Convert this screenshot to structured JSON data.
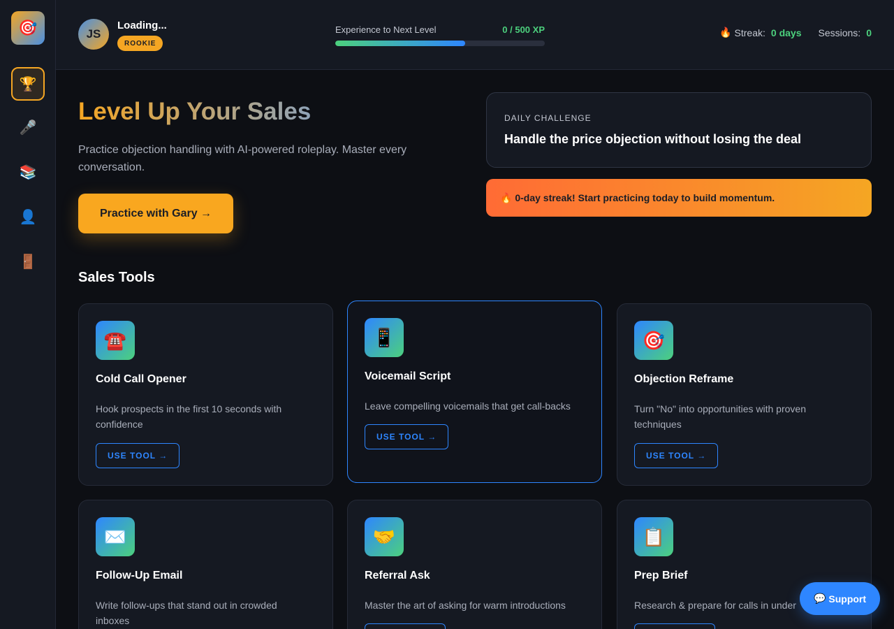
{
  "sidebar": {
    "logo_icon": "🎯",
    "items": [
      {
        "name": "dashboard",
        "icon": "🏆",
        "active": true
      },
      {
        "name": "practice",
        "icon": "🎤",
        "active": false
      },
      {
        "name": "library",
        "icon": "📚",
        "active": false
      },
      {
        "name": "profile",
        "icon": "👤",
        "active": false
      },
      {
        "name": "logout",
        "icon": "🚪",
        "active": false
      }
    ]
  },
  "header": {
    "avatar_initials": "JS",
    "user_name": "Loading...",
    "rank": "ROOKIE",
    "xp_label": "Experience to Next Level",
    "xp_value": "0 / 500 XP",
    "streak_icon": "🔥",
    "streak_label": "Streak:",
    "streak_value": "0 days",
    "sessions_label": "Sessions:",
    "sessions_value": "0"
  },
  "hero": {
    "title": "Level Up Your Sales",
    "description": "Practice objection handling with AI-powered roleplay. Master every conversation.",
    "cta_label": "Practice with Gary →"
  },
  "daily_challenge": {
    "label": "DAILY CHALLENGE",
    "text": "Handle the price objection without losing the deal"
  },
  "streak_banner": {
    "text": "🔥 0-day streak! Start practicing today to build momentum."
  },
  "tools": {
    "section_title": "Sales Tools",
    "button_label": "USE TOOL →",
    "items": [
      {
        "icon": "☎️",
        "name": "Cold Call Opener",
        "description": "Hook prospects in the first 10 seconds with confidence"
      },
      {
        "icon": "📱",
        "name": "Voicemail Script",
        "description": "Leave compelling voicemails that get call-backs"
      },
      {
        "icon": "🎯",
        "name": "Objection Reframe",
        "description": "Turn \"No\" into opportunities with proven techniques"
      },
      {
        "icon": "✉️",
        "name": "Follow-Up Email",
        "description": "Write follow-ups that stand out in crowded inboxes"
      },
      {
        "icon": "🤝",
        "name": "Referral Ask",
        "description": "Master the art of asking for warm introductions"
      },
      {
        "icon": "📋",
        "name": "Prep Brief",
        "description": "Research & prepare for calls in under"
      }
    ]
  },
  "support": {
    "icon": "💬",
    "label": "Support"
  },
  "colors": {
    "background": "#0d0f14",
    "panel": "#151922",
    "accent_orange": "#f5a623",
    "accent_blue": "#2e86ff",
    "accent_green": "#4cd07d"
  }
}
